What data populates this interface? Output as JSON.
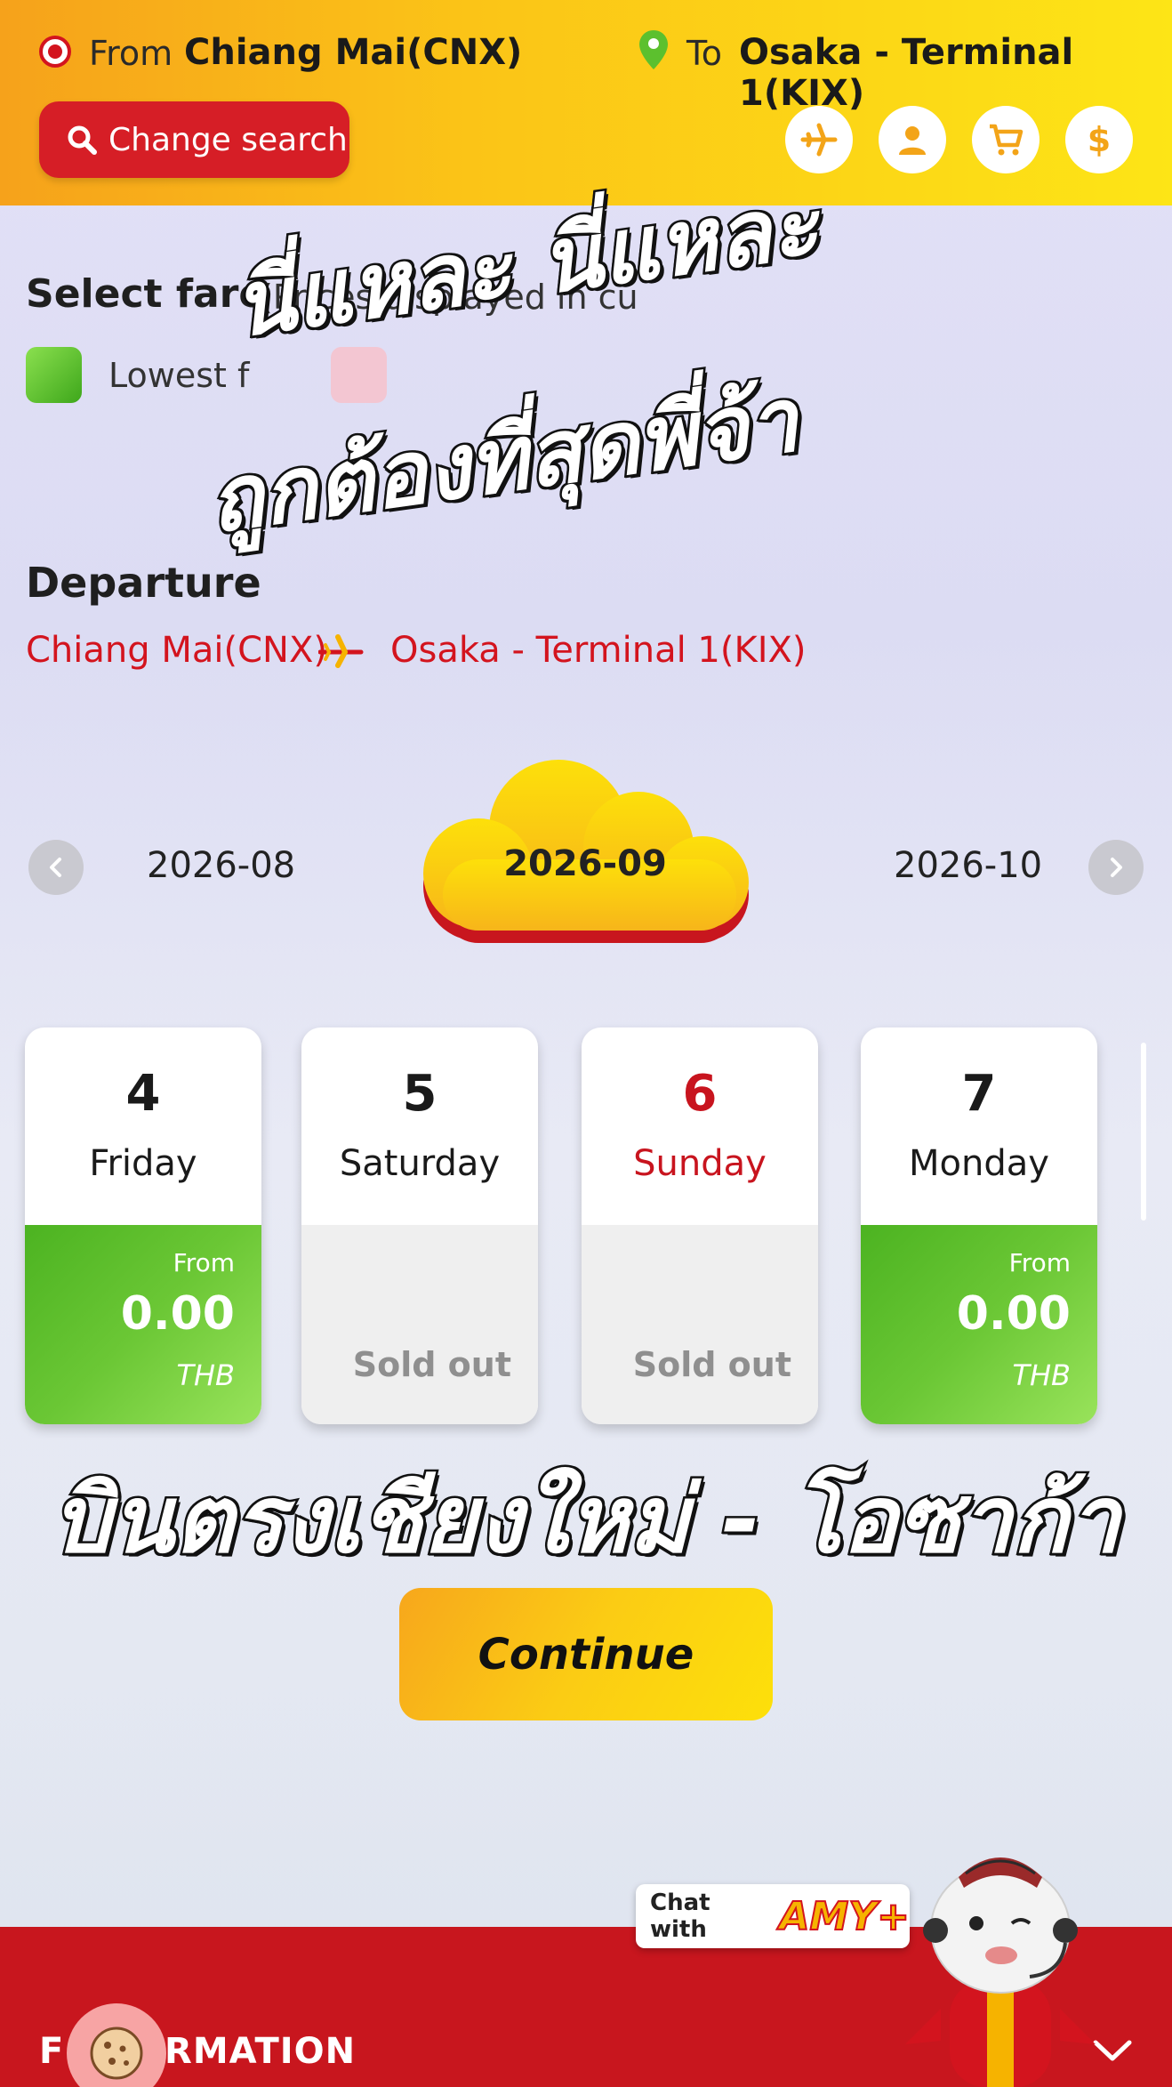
{
  "header": {
    "from_label": "From",
    "from_value": "Chiang Mai(CNX)",
    "to_label": "To",
    "to_value": "Osaka - Terminal 1(KIX)",
    "change_search_label": "Change search",
    "icons": [
      "plane-icon",
      "user-icon",
      "cart-icon",
      "dollar-icon"
    ],
    "currency_symbol": "$"
  },
  "fare": {
    "title": "Select fare",
    "price_note": "(Prices displayed in cu",
    "legend_lowest": "Lowest f"
  },
  "departure": {
    "title": "Departure",
    "from": "Chiang Mai(CNX)",
    "to": "Osaka - Terminal 1(KIX)"
  },
  "months": {
    "previous": "2026-08",
    "current": "2026-09",
    "next": "2026-10"
  },
  "days": [
    {
      "num": "4",
      "name": "Friday",
      "status": "available",
      "from_label": "From",
      "price": "0.00",
      "currency": "THB"
    },
    {
      "num": "5",
      "name": "Saturday",
      "status": "sold_out",
      "sold_out_label": "Sold out"
    },
    {
      "num": "6",
      "name": "Sunday",
      "status": "sold_out",
      "sold_out_label": "Sold out"
    },
    {
      "num": "7",
      "name": "Monday",
      "status": "available",
      "from_label": "From",
      "price": "0.00",
      "currency": "THB"
    }
  ],
  "overlay": {
    "line1": "นี่แหละ นี่แหละ",
    "line2": "ถูกต้องที่สุดพี่จ้า",
    "line3": "บินตรงเชียงใหม่ - โอซาก้า"
  },
  "continue_label": "Continue",
  "footer": {
    "title": "F    NFORMATION",
    "chat_text": "Chat with",
    "chat_brand": "AMY+"
  },
  "colors": {
    "brand_red": "#d3141e",
    "brand_yellow": "#fbc417",
    "available_green": "#4cb321"
  }
}
